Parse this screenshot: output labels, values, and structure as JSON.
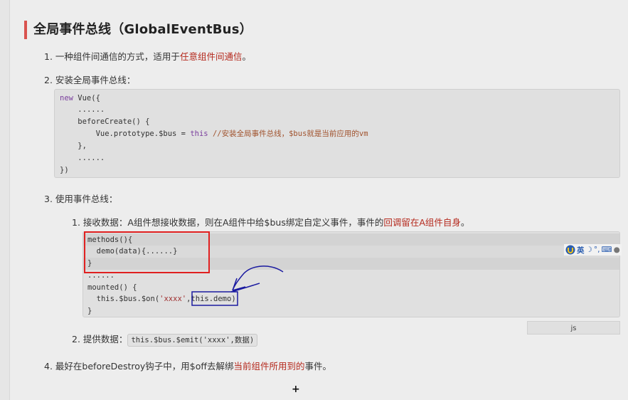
{
  "heading": "全局事件总线（GlobalEventBus）",
  "item1": {
    "num": "1.",
    "text": "一种组件间通信的方式，适用于",
    "highlight": "任意组件间通信",
    "end": "。"
  },
  "item2": {
    "num": "2.",
    "text": "安装全局事件总线："
  },
  "code1": {
    "lines": [
      {
        "kw": "new",
        "rest": " Vue({"
      },
      {
        "indent": "    ",
        "text": "......"
      },
      {
        "indent": "    ",
        "text": "beforeCreate() {"
      },
      {
        "indent": "        ",
        "text": "Vue.prototype.$bus = ",
        "kw": "this",
        "comment": " //安装全局事件总线，$bus就是当前应用的vm"
      },
      {
        "indent": "    ",
        "text": "},"
      },
      {
        "indent": "    ",
        "text": "......"
      },
      {
        "indent": "",
        "text": "})"
      }
    ]
  },
  "item3": {
    "num": "3.",
    "text": "使用事件总线："
  },
  "sub1": {
    "num": "1.",
    "text": "接收数据：A组件想接收数据，则在A组件中给$bus绑定自定义事件，事件的",
    "highlight": "回调留在A组件自身",
    "end": "。"
  },
  "code2": {
    "l1": "methods(){",
    "l2": "  demo(data){......}",
    "l3": "}",
    "l4": "......",
    "l5": "mounted() {",
    "l6a": "  this.$bus.$on(",
    "l6str": "'xxxx'",
    "l6comma": ",",
    "l6b": "this.demo",
    "l6c": ")",
    "l7": "}"
  },
  "lang_tag": "js",
  "ime": {
    "label": "英",
    "icons": [
      "moon-icon",
      "punct-icon",
      "keyboard-icon",
      "user-icon"
    ]
  },
  "sub2": {
    "num": "2.",
    "text": "提供数据：",
    "code": "this.$bus.$emit('xxxx',数据)"
  },
  "item4": {
    "num": "4.",
    "text": "最好在beforeDestroy钩子中，用$off去解绑",
    "highlight": "当前组件所用到的",
    "end": "事件。"
  },
  "colors": {
    "accent": "#d9534f",
    "highlight_text": "#b52a1e",
    "annotation_red": "#e02020",
    "annotation_blue": "#1a1aa0"
  }
}
